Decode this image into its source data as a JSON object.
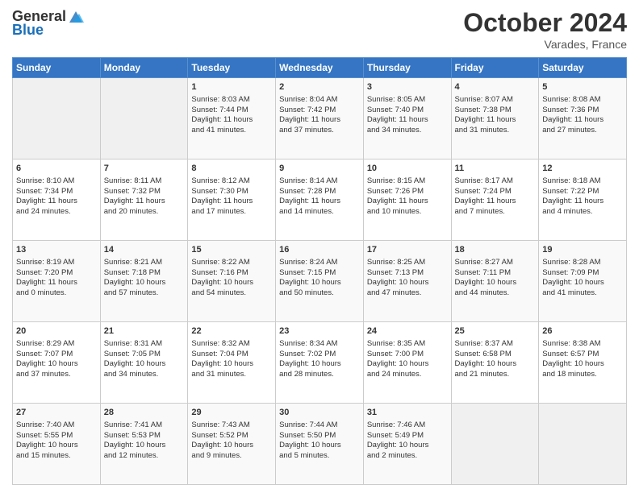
{
  "header": {
    "logo_general": "General",
    "logo_blue": "Blue",
    "month": "October 2024",
    "location": "Varades, France"
  },
  "days_of_week": [
    "Sunday",
    "Monday",
    "Tuesday",
    "Wednesday",
    "Thursday",
    "Friday",
    "Saturday"
  ],
  "weeks": [
    [
      {
        "day": "",
        "empty": true
      },
      {
        "day": "",
        "empty": true
      },
      {
        "day": "1",
        "line1": "Sunrise: 8:03 AM",
        "line2": "Sunset: 7:44 PM",
        "line3": "Daylight: 11 hours",
        "line4": "and 41 minutes."
      },
      {
        "day": "2",
        "line1": "Sunrise: 8:04 AM",
        "line2": "Sunset: 7:42 PM",
        "line3": "Daylight: 11 hours",
        "line4": "and 37 minutes."
      },
      {
        "day": "3",
        "line1": "Sunrise: 8:05 AM",
        "line2": "Sunset: 7:40 PM",
        "line3": "Daylight: 11 hours",
        "line4": "and 34 minutes."
      },
      {
        "day": "4",
        "line1": "Sunrise: 8:07 AM",
        "line2": "Sunset: 7:38 PM",
        "line3": "Daylight: 11 hours",
        "line4": "and 31 minutes."
      },
      {
        "day": "5",
        "line1": "Sunrise: 8:08 AM",
        "line2": "Sunset: 7:36 PM",
        "line3": "Daylight: 11 hours",
        "line4": "and 27 minutes."
      }
    ],
    [
      {
        "day": "6",
        "line1": "Sunrise: 8:10 AM",
        "line2": "Sunset: 7:34 PM",
        "line3": "Daylight: 11 hours",
        "line4": "and 24 minutes."
      },
      {
        "day": "7",
        "line1": "Sunrise: 8:11 AM",
        "line2": "Sunset: 7:32 PM",
        "line3": "Daylight: 11 hours",
        "line4": "and 20 minutes."
      },
      {
        "day": "8",
        "line1": "Sunrise: 8:12 AM",
        "line2": "Sunset: 7:30 PM",
        "line3": "Daylight: 11 hours",
        "line4": "and 17 minutes."
      },
      {
        "day": "9",
        "line1": "Sunrise: 8:14 AM",
        "line2": "Sunset: 7:28 PM",
        "line3": "Daylight: 11 hours",
        "line4": "and 14 minutes."
      },
      {
        "day": "10",
        "line1": "Sunrise: 8:15 AM",
        "line2": "Sunset: 7:26 PM",
        "line3": "Daylight: 11 hours",
        "line4": "and 10 minutes."
      },
      {
        "day": "11",
        "line1": "Sunrise: 8:17 AM",
        "line2": "Sunset: 7:24 PM",
        "line3": "Daylight: 11 hours",
        "line4": "and 7 minutes."
      },
      {
        "day": "12",
        "line1": "Sunrise: 8:18 AM",
        "line2": "Sunset: 7:22 PM",
        "line3": "Daylight: 11 hours",
        "line4": "and 4 minutes."
      }
    ],
    [
      {
        "day": "13",
        "line1": "Sunrise: 8:19 AM",
        "line2": "Sunset: 7:20 PM",
        "line3": "Daylight: 11 hours",
        "line4": "and 0 minutes."
      },
      {
        "day": "14",
        "line1": "Sunrise: 8:21 AM",
        "line2": "Sunset: 7:18 PM",
        "line3": "Daylight: 10 hours",
        "line4": "and 57 minutes."
      },
      {
        "day": "15",
        "line1": "Sunrise: 8:22 AM",
        "line2": "Sunset: 7:16 PM",
        "line3": "Daylight: 10 hours",
        "line4": "and 54 minutes."
      },
      {
        "day": "16",
        "line1": "Sunrise: 8:24 AM",
        "line2": "Sunset: 7:15 PM",
        "line3": "Daylight: 10 hours",
        "line4": "and 50 minutes."
      },
      {
        "day": "17",
        "line1": "Sunrise: 8:25 AM",
        "line2": "Sunset: 7:13 PM",
        "line3": "Daylight: 10 hours",
        "line4": "and 47 minutes."
      },
      {
        "day": "18",
        "line1": "Sunrise: 8:27 AM",
        "line2": "Sunset: 7:11 PM",
        "line3": "Daylight: 10 hours",
        "line4": "and 44 minutes."
      },
      {
        "day": "19",
        "line1": "Sunrise: 8:28 AM",
        "line2": "Sunset: 7:09 PM",
        "line3": "Daylight: 10 hours",
        "line4": "and 41 minutes."
      }
    ],
    [
      {
        "day": "20",
        "line1": "Sunrise: 8:29 AM",
        "line2": "Sunset: 7:07 PM",
        "line3": "Daylight: 10 hours",
        "line4": "and 37 minutes."
      },
      {
        "day": "21",
        "line1": "Sunrise: 8:31 AM",
        "line2": "Sunset: 7:05 PM",
        "line3": "Daylight: 10 hours",
        "line4": "and 34 minutes."
      },
      {
        "day": "22",
        "line1": "Sunrise: 8:32 AM",
        "line2": "Sunset: 7:04 PM",
        "line3": "Daylight: 10 hours",
        "line4": "and 31 minutes."
      },
      {
        "day": "23",
        "line1": "Sunrise: 8:34 AM",
        "line2": "Sunset: 7:02 PM",
        "line3": "Daylight: 10 hours",
        "line4": "and 28 minutes."
      },
      {
        "day": "24",
        "line1": "Sunrise: 8:35 AM",
        "line2": "Sunset: 7:00 PM",
        "line3": "Daylight: 10 hours",
        "line4": "and 24 minutes."
      },
      {
        "day": "25",
        "line1": "Sunrise: 8:37 AM",
        "line2": "Sunset: 6:58 PM",
        "line3": "Daylight: 10 hours",
        "line4": "and 21 minutes."
      },
      {
        "day": "26",
        "line1": "Sunrise: 8:38 AM",
        "line2": "Sunset: 6:57 PM",
        "line3": "Daylight: 10 hours",
        "line4": "and 18 minutes."
      }
    ],
    [
      {
        "day": "27",
        "line1": "Sunrise: 7:40 AM",
        "line2": "Sunset: 5:55 PM",
        "line3": "Daylight: 10 hours",
        "line4": "and 15 minutes."
      },
      {
        "day": "28",
        "line1": "Sunrise: 7:41 AM",
        "line2": "Sunset: 5:53 PM",
        "line3": "Daylight: 10 hours",
        "line4": "and 12 minutes."
      },
      {
        "day": "29",
        "line1": "Sunrise: 7:43 AM",
        "line2": "Sunset: 5:52 PM",
        "line3": "Daylight: 10 hours",
        "line4": "and 9 minutes."
      },
      {
        "day": "30",
        "line1": "Sunrise: 7:44 AM",
        "line2": "Sunset: 5:50 PM",
        "line3": "Daylight: 10 hours",
        "line4": "and 5 minutes."
      },
      {
        "day": "31",
        "line1": "Sunrise: 7:46 AM",
        "line2": "Sunset: 5:49 PM",
        "line3": "Daylight: 10 hours",
        "line4": "and 2 minutes."
      },
      {
        "day": "",
        "empty": true
      },
      {
        "day": "",
        "empty": true
      }
    ]
  ]
}
